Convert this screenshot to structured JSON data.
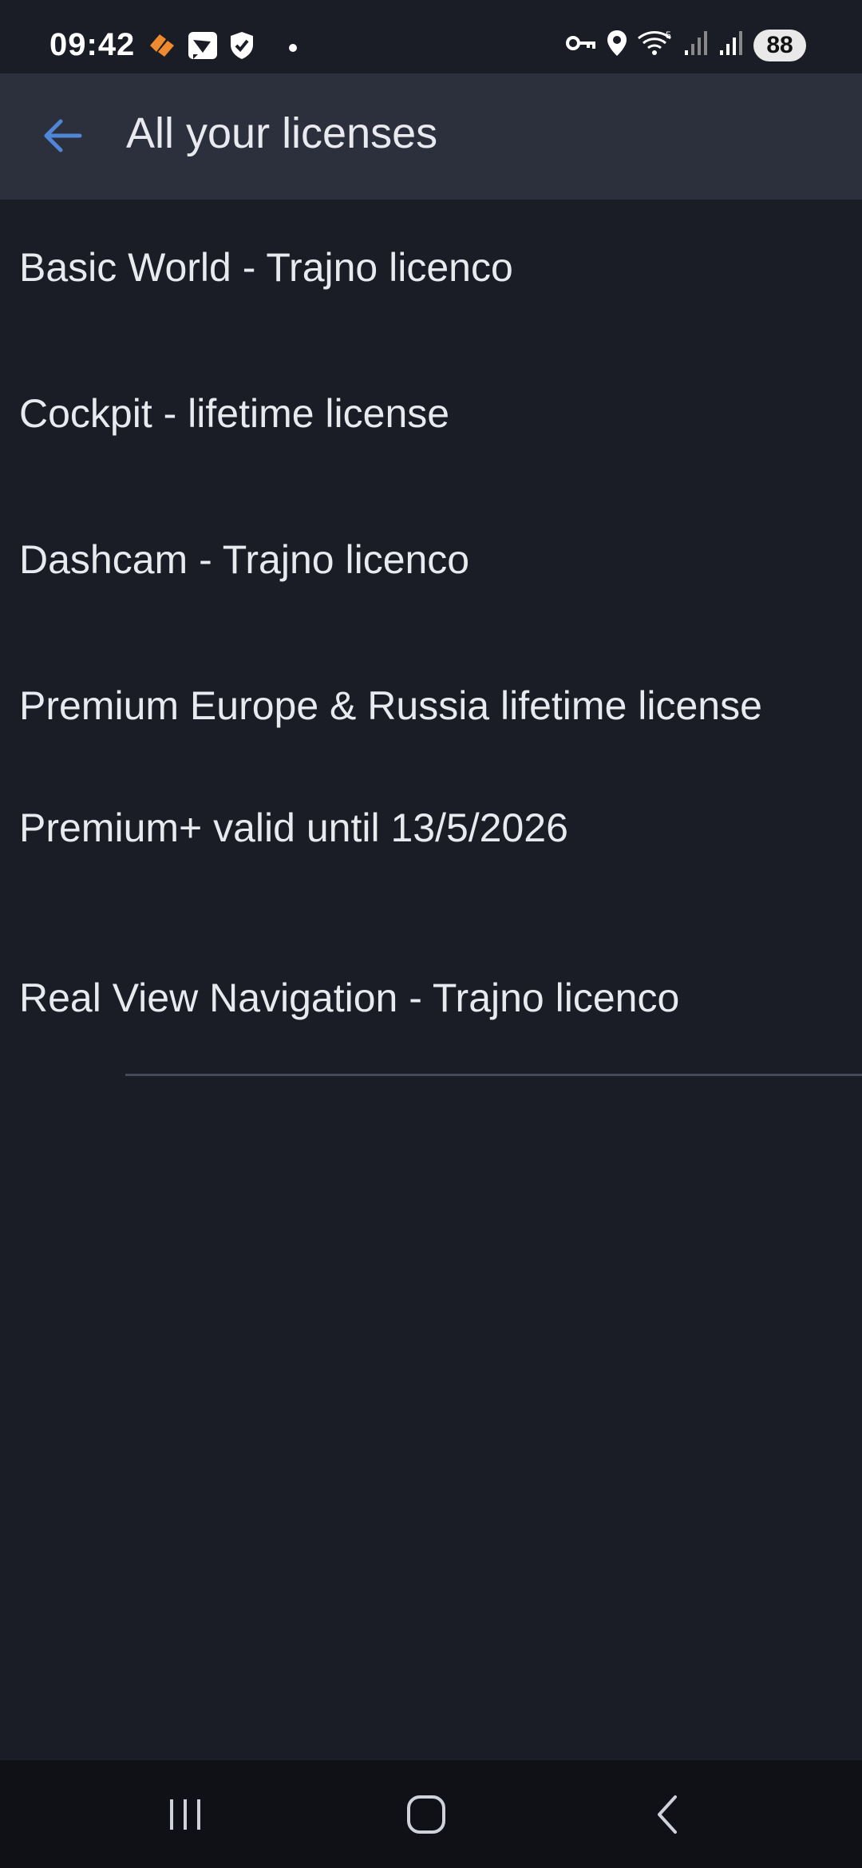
{
  "status_bar": {
    "time": "09:42",
    "battery": "88",
    "left_icons": [
      "app-notification-icon",
      "cast-icon",
      "shield-icon",
      "dot-icon"
    ],
    "right_icons": [
      "vpn-key-icon",
      "location-icon",
      "wifi-icon",
      "signal-icon",
      "signal-icon"
    ]
  },
  "app_bar": {
    "title": "All your licenses",
    "back_icon": "arrow-left-icon",
    "accent_color": "#4f86d6"
  },
  "licenses": [
    "Basic World - Trajno licenco",
    "Cockpit - lifetime license",
    "Dashcam - Trajno licenco",
    "Premium Europe & Russia lifetime license",
    "Premium+ valid until 13/5/2026",
    "Real View Navigation - Trajno licenco"
  ],
  "nav_bar": {
    "recents_icon": "recents-icon",
    "home_icon": "home-icon",
    "back_icon": "back-chevron-icon"
  }
}
